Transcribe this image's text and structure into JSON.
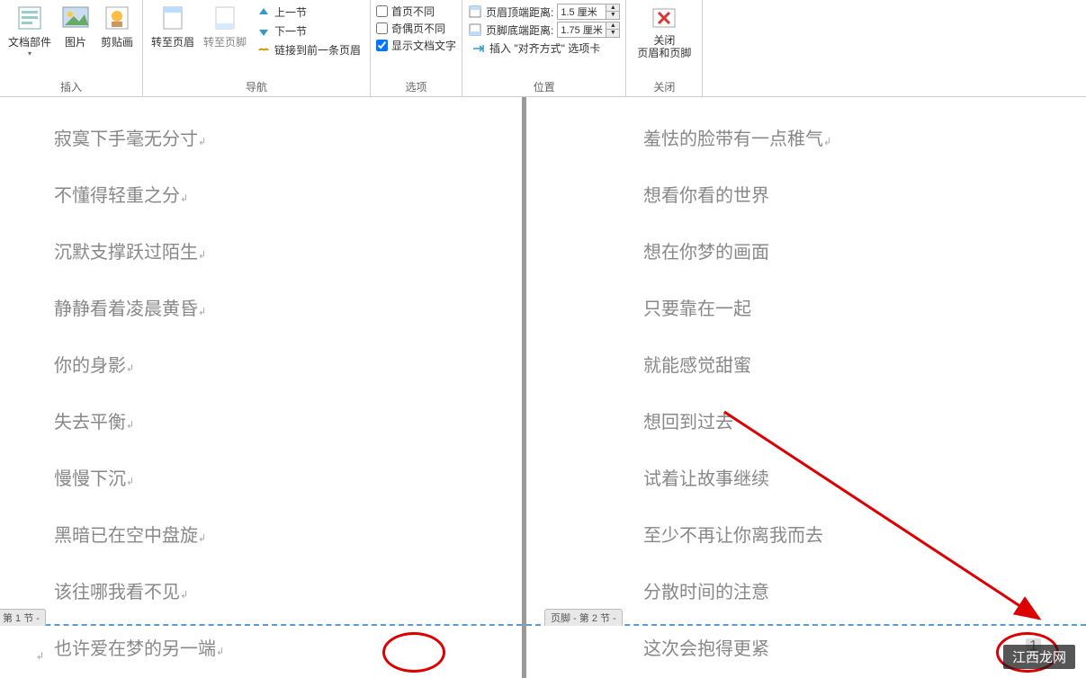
{
  "ribbon": {
    "insert": {
      "label": "插入",
      "doc_parts": "文档部件",
      "picture": "图片",
      "clipart": "剪贴画"
    },
    "nav": {
      "label": "导航",
      "goto_header": "转至页眉",
      "goto_footer": "转至页脚",
      "prev_section": "上一节",
      "next_section": "下一节",
      "link_prev": "链接到前一条页眉"
    },
    "options": {
      "label": "选项",
      "first_page_diff": "首页不同",
      "odd_even_diff": "奇偶页不同",
      "show_doc_text": "显示文档文字"
    },
    "position": {
      "label": "位置",
      "header_top": "页眉顶端距离:",
      "header_top_val": "1.5 厘米",
      "footer_bottom": "页脚底端距离:",
      "footer_bottom_val": "1.75 厘米",
      "insert_align_tab": "插入 \"对齐方式\" 选项卡"
    },
    "close": {
      "label": "关闭",
      "btn_top": "关闭",
      "btn_bottom": "页眉和页脚"
    }
  },
  "document": {
    "left_lines": [
      "寂寞下手毫无分寸",
      "不懂得轻重之分",
      "沉默支撑跃过陌生",
      "静静看着凌晨黄昏",
      "  你的身影",
      "失去平衡",
      "慢慢下沉",
      "黑暗已在空中盘旋",
      "该往哪我看不见",
      "也许爱在梦的另一端"
    ],
    "right_lines": [
      "羞怯的脸带有一点稚气",
      "想看你看的世界",
      "想在你梦的画面",
      "只要靠在一起",
      "就能感觉甜蜜",
      "想回到过去",
      "试着让故事继续",
      "至少不再让你离我而去",
      "分散时间的注意",
      "这次会抱得更紧"
    ],
    "footer_left_tab": "第 1 节 -",
    "footer_right_tab": "页脚 - 第 2 节 -",
    "page_number_right": "1",
    "return_mark": "↲"
  },
  "watermark": "江西龙网"
}
